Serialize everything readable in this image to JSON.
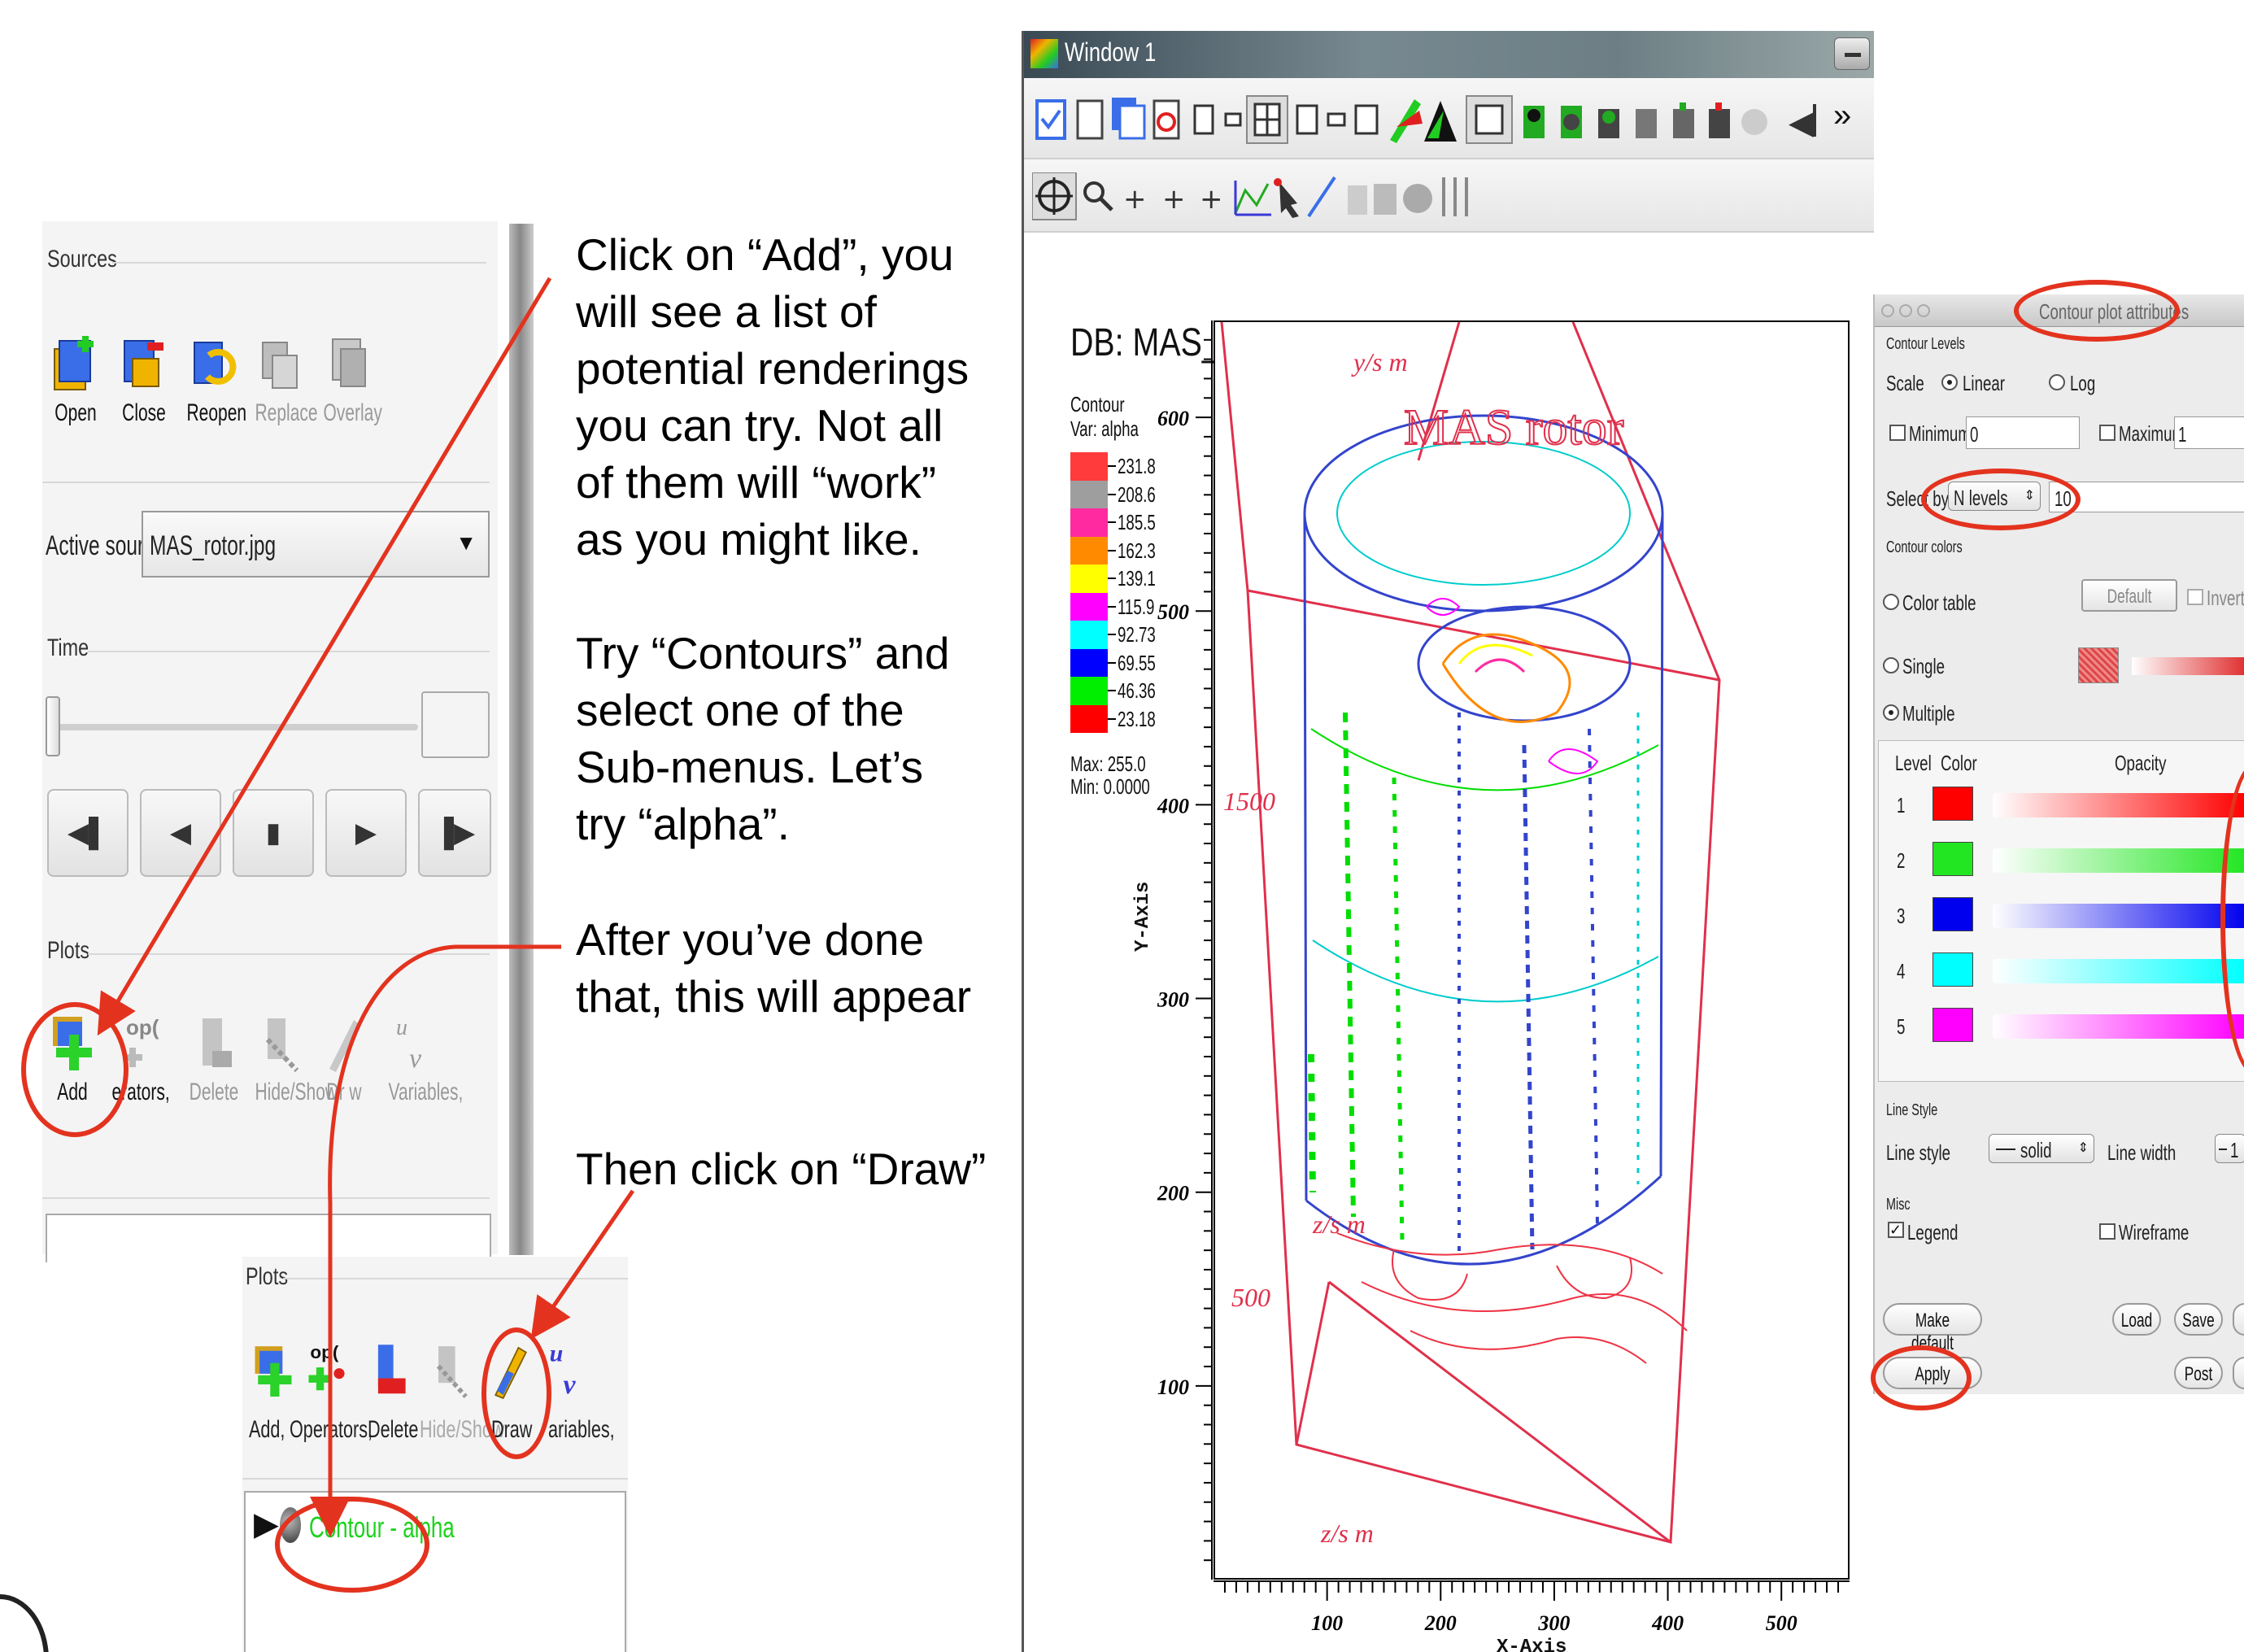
{
  "left_panel": {
    "sources": {
      "title": "Sources",
      "buttons": [
        {
          "label": "Open",
          "icon": "open-icon"
        },
        {
          "label": "Close",
          "icon": "close-icon"
        },
        {
          "label": "Reopen",
          "icon": "reopen-icon"
        },
        {
          "label": "Replace",
          "icon": "replace-icon"
        },
        {
          "label": "Overlay",
          "icon": "overlay-icon"
        }
      ]
    },
    "active_source": {
      "label": "Active source",
      "value": "MAS_rotor.jpg"
    },
    "time": {
      "title": "Time"
    },
    "plots": {
      "title": "Plots",
      "buttons": [
        {
          "label": "Add",
          "icon": "add-icon"
        },
        {
          "label": "Operators",
          "icon": "operators-icon",
          "label_partial": "erators,"
        },
        {
          "label": "Delete",
          "icon": "delete-icon"
        },
        {
          "label": "Hide/Show",
          "icon": "hide-show-icon"
        },
        {
          "label": "Draw",
          "icon": "draw-icon",
          "label_partial": "Dr w"
        },
        {
          "label": "Variables",
          "icon": "variables-icon",
          "label_partial": "Variables,"
        }
      ]
    }
  },
  "plots_panel_2": {
    "title": "Plots",
    "buttons": [
      {
        "label": "Add,"
      },
      {
        "label": "Operators,"
      },
      {
        "label": "Delete"
      },
      {
        "label": "Hide/Show"
      },
      {
        "label": "Draw"
      },
      {
        "label": "ariables,"
      }
    ],
    "plot_item": "Contour - alpha"
  },
  "annotations": {
    "step1": [
      "Click on “Add”, you",
      "will see a list of",
      "potential renderings",
      "you can try. Not all",
      "of them will “work”",
      "as you might like."
    ],
    "step2": [
      "Try “Contours” and",
      "select one of the",
      "Sub-menus. Let’s",
      "try “alpha”."
    ],
    "step3": [
      "After you’ve done",
      "that, this will appear"
    ],
    "step4": [
      "Then click on “Draw”"
    ]
  },
  "window": {
    "title": "Window 1",
    "overflow_glyph": "»"
  },
  "plot": {
    "db_label": "DB: MAS_rotor.jpg",
    "legend": {
      "title": "Contour",
      "var": "Var: alpha",
      "levels": [
        "231.8",
        "208.6",
        "185.5",
        "162.3",
        "139.1",
        "115.9",
        "92.73",
        "69.55",
        "46.36",
        "23.18"
      ],
      "colors": [
        "#ff3b3b",
        "#9e9e9e",
        "#ff2aa0",
        "#ff8a00",
        "#ffff00",
        "#ff00ff",
        "#00ffff",
        "#0000ff",
        "#00ee00",
        "#ff0000"
      ],
      "max": "Max: 255.0",
      "min": "Min: 0.0000"
    },
    "yaxis_label": "Y-Axis",
    "xaxis_label": "X-Axis",
    "inner_text": "MAS rotor"
  },
  "chart_data": {
    "type": "scatter",
    "y_ticks": [
      "600",
      "500",
      "400",
      "300",
      "200",
      "100"
    ],
    "x_ticks": [
      "100",
      "200",
      "300",
      "400",
      "500"
    ],
    "ylim": [
      0,
      650
    ],
    "xlim": [
      0,
      560
    ],
    "ylabel": "Y-Axis",
    "xlabel": "X-Axis"
  },
  "contour_attrs": {
    "title": "Contour plot attributes",
    "contour_levels": "Contour Levels",
    "scale_label": "Scale",
    "scale_linear": "Linear",
    "scale_log": "Log",
    "minimum_label": "Minimum",
    "minimum_value": "0",
    "maximum_label": "Maximum",
    "maximum_value": "1",
    "select_by_label": "Select by",
    "select_by_value": "N levels",
    "select_by_count": "10",
    "contour_colors": "Contour colors",
    "color_table": "Color table",
    "default_btn": "Default",
    "invert": "Invert",
    "single": "Single",
    "multiple": "Multiple",
    "col_level": "Level",
    "col_color": "Color",
    "col_opacity": "Opacity",
    "levels": [
      {
        "level": "1",
        "color": "#ff0000"
      },
      {
        "level": "2",
        "color": "#22e622"
      },
      {
        "level": "3",
        "color": "#0000ee"
      },
      {
        "level": "4",
        "color": "#00ffff"
      },
      {
        "level": "5",
        "color": "#ff00ff"
      }
    ],
    "line_style_section": "Line Style",
    "line_style_label": "Line style",
    "line_style_value": "solid",
    "line_width_label": "Line width",
    "line_width_value": "1",
    "misc": "Misc",
    "legend": "Legend",
    "wireframe": "Wireframe",
    "make_default": "Make default",
    "load": "Load",
    "save": "Save",
    "apply": "Apply",
    "post": "Post"
  }
}
